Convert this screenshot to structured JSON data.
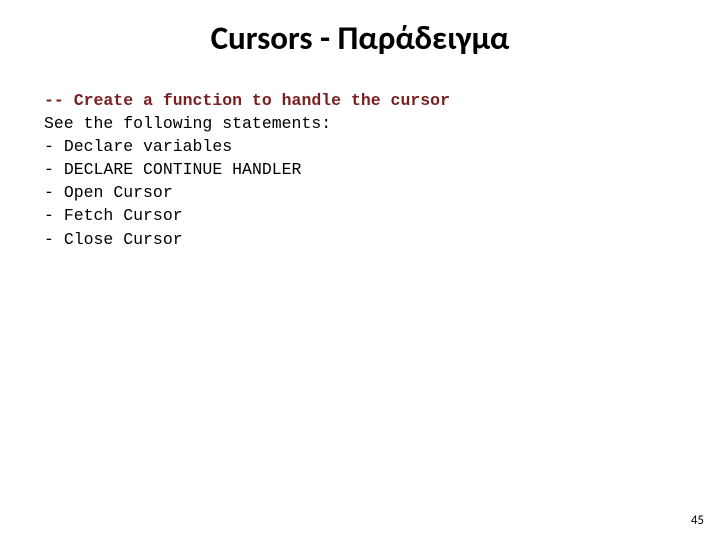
{
  "title": "Cursors - Παράδειγμα",
  "comment": "-- Create a function to handle the cursor",
  "intro": "See the following statements:",
  "bullet_prefix": "- ",
  "items": [
    "Declare variables",
    "DECLARE CONTINUE HANDLER",
    "Open Cursor",
    "Fetch Cursor",
    "Close Cursor"
  ],
  "page_number": "45"
}
